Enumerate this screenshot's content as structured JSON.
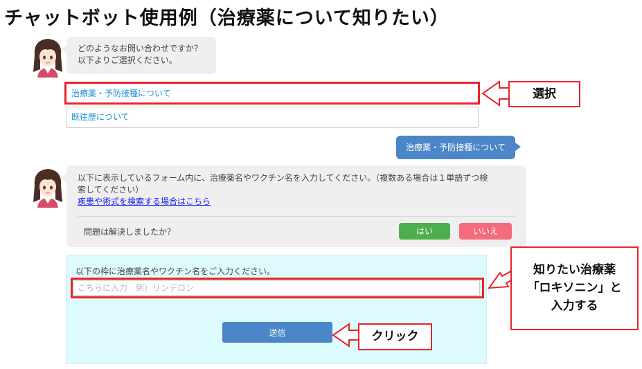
{
  "page": {
    "title": "チャットボット使用例（治療薬について知りたい）"
  },
  "chat": {
    "greeting": {
      "line1": "どのようなお問い合わせですか？",
      "line2": "以下よりご選択ください。"
    },
    "options": [
      {
        "label": "治療薬・予防接種について"
      },
      {
        "label": "既往歴について"
      }
    ],
    "user_reply": "治療薬・予防接種について",
    "bot_reply": {
      "line1": "以下に表示しているフォーム内に、治療薬名やワクチン名を入力してください。（複数ある場合は１単語ずつ検",
      "line2": "索してください）",
      "link": "疾患や術式を検索する場合はこちら",
      "question": "問題は解決しましたか？",
      "yes_label": "はい",
      "no_label": "いいえ"
    },
    "colors": {
      "yes": "#4cae4c",
      "no": "#f36b7c",
      "accent": "#4a86c8",
      "highlight": "#e8242a"
    }
  },
  "form": {
    "label": "以下の枠に治療薬名やワクチン名をご入力ください。",
    "input_value": "",
    "input_placeholder": "こちらに入力　例）リンデロン",
    "submit_label": "送信"
  },
  "annotations": {
    "select": "選択",
    "enter_line1": "知りたい治療薬",
    "enter_line2": "「ロキソニン」と",
    "enter_line3": "入力する",
    "click": "クリック"
  }
}
